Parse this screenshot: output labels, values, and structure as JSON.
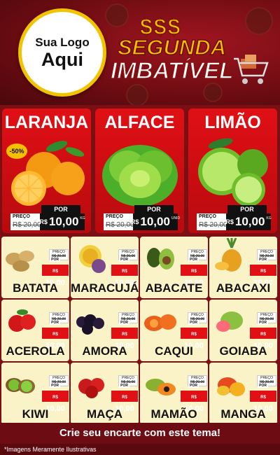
{
  "header": {
    "logo_line1": "Sua Logo",
    "logo_line2": "Aqui",
    "dollars": "$$$",
    "title_line1": "SEGUNDA",
    "title_line2": "IMBATÍVEL"
  },
  "featured": [
    {
      "name": "LARANJA",
      "badge": "-50%",
      "preco_label": "PREÇO",
      "old_price": "R$ 20,00",
      "por_label": "POR",
      "currency": "R$",
      "price": "10,00",
      "unit": "KG"
    },
    {
      "name": "ALFACE",
      "preco_label": "PREÇO",
      "old_price": "R$ 20,00",
      "por_label": "POR",
      "currency": "R$",
      "price": "10,00",
      "unit": "UNID"
    },
    {
      "name": "LIMÃO",
      "preco_label": "PREÇO",
      "old_price": "R$ 20,00",
      "por_label": "POR",
      "currency": "R$",
      "price": "10,00",
      "unit": "KG"
    }
  ],
  "products": [
    {
      "name": "BATATA"
    },
    {
      "name": "MARACUJÁ"
    },
    {
      "name": "ABACATE"
    },
    {
      "name": "ABACAXI"
    },
    {
      "name": "ACEROLA"
    },
    {
      "name": "AMORA"
    },
    {
      "name": "CAQUI"
    },
    {
      "name": "GOIABA"
    },
    {
      "name": "KIWI"
    },
    {
      "name": "MAÇA"
    },
    {
      "name": "MAMÃO"
    },
    {
      "name": "MANGA"
    }
  ],
  "small_price": {
    "preco_label": "PREÇO",
    "old_price": "R$ 20,00",
    "por_label": "POR",
    "currency": "R$",
    "price": "10,00"
  },
  "footer": {
    "cta": "Crie seu encarte com este tema!",
    "disclaimer": "*Imagens Meramente Ilustrativas"
  },
  "colors": {
    "accent_red": "#e01015",
    "gold": "#f5c000",
    "dark": "#111111",
    "cream": "#fbf3c8"
  }
}
